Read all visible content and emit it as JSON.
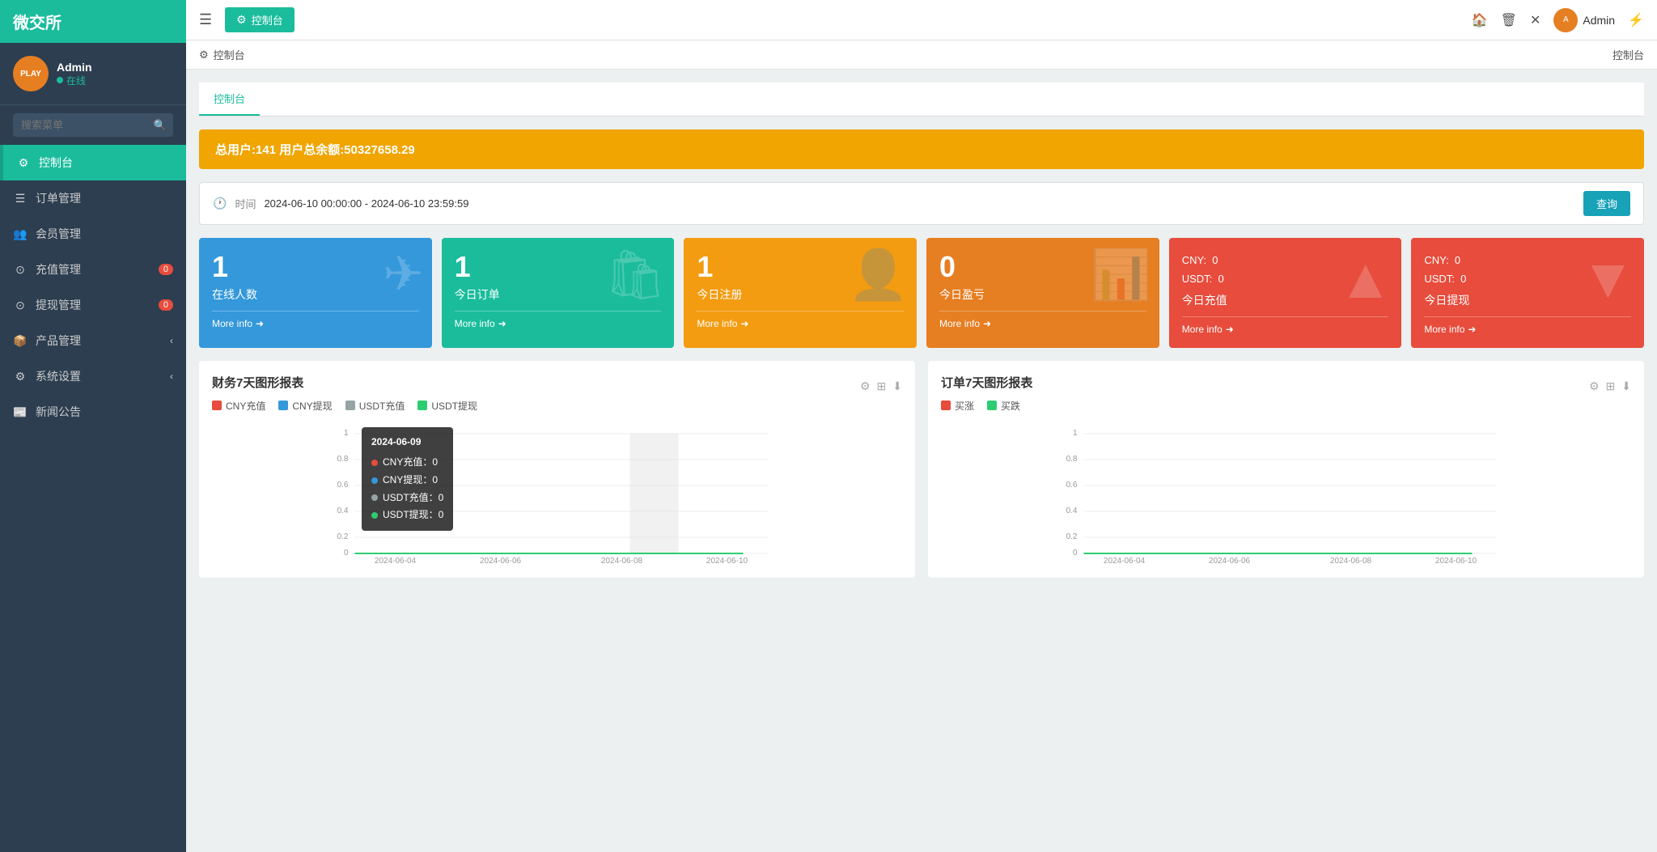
{
  "app": {
    "title": "微交所",
    "logo_text": "微交所"
  },
  "user": {
    "name": "Admin",
    "status": "在线",
    "avatar_text": "PLAY"
  },
  "sidebar": {
    "search_placeholder": "搜索菜单",
    "nav_items": [
      {
        "id": "dashboard",
        "label": "控制台",
        "icon": "⚙",
        "active": true,
        "badge": null,
        "arrow": false
      },
      {
        "id": "orders",
        "label": "订单管理",
        "icon": "☰",
        "active": false,
        "badge": null,
        "arrow": false
      },
      {
        "id": "members",
        "label": "会员管理",
        "icon": "👥",
        "active": false,
        "badge": null,
        "arrow": false
      },
      {
        "id": "recharge",
        "label": "充值管理",
        "icon": "◎",
        "active": false,
        "badge": "0",
        "arrow": false
      },
      {
        "id": "withdraw",
        "label": "提现管理",
        "icon": "◎",
        "active": false,
        "badge": "0",
        "arrow": false
      },
      {
        "id": "products",
        "label": "产品管理",
        "icon": "📦",
        "active": false,
        "badge": null,
        "arrow": true
      },
      {
        "id": "settings",
        "label": "系统设置",
        "icon": "⚙",
        "active": false,
        "badge": null,
        "arrow": true
      },
      {
        "id": "news",
        "label": "新闻公告",
        "icon": "📰",
        "active": false,
        "badge": null,
        "arrow": false
      }
    ]
  },
  "topbar": {
    "tab_label": "控制台",
    "tab_icon": "⚙",
    "user_name": "Admin",
    "breadcrumb_left": "控制台",
    "breadcrumb_right": "控制台"
  },
  "stats_banner": {
    "text": "总用户:141   用户总余额:50327658.29"
  },
  "date_filter": {
    "label": "时间",
    "value": "2024-06-10 00:00:00 - 2024-06-10 23:59:59",
    "btn_label": "查询"
  },
  "metric_cards": [
    {
      "id": "online_users",
      "number": "1",
      "label": "在线人数",
      "more": "More info",
      "bg_icon": "✈",
      "color": "blue"
    },
    {
      "id": "today_orders",
      "number": "1",
      "label": "今日订单",
      "more": "More info",
      "bg_icon": "🛍",
      "color": "green"
    },
    {
      "id": "today_register",
      "number": "1",
      "label": "今日注册",
      "more": "More info",
      "bg_icon": "👤",
      "color": "orange"
    },
    {
      "id": "today_profit",
      "number": "0",
      "label": "今日盈亏",
      "more": "More info",
      "bg_icon": "📊",
      "color": "yellow_dark"
    },
    {
      "id": "today_recharge",
      "label": "今日充值",
      "more": "More info",
      "sub_lines": [
        "CNY:  0",
        "USDT:  0"
      ],
      "bg_icon": "▲",
      "color": "red"
    },
    {
      "id": "today_withdraw",
      "label": "今日提现",
      "more": "More info",
      "sub_lines": [
        "CNY:  0",
        "USDT:  0"
      ],
      "bg_icon": "▼",
      "color": "red"
    }
  ],
  "finance_chart": {
    "title": "财务7天图形报表",
    "legend": [
      {
        "label": "CNY充值",
        "color": "#e74c3c"
      },
      {
        "label": "CNY提现",
        "color": "#3498db"
      },
      {
        "label": "USDT充值",
        "color": "#95a5a6"
      },
      {
        "label": "USDT提现",
        "color": "#2ecc71"
      }
    ],
    "x_labels": [
      "2024-06-04",
      "2024-06-06",
      "2024-06-08",
      "2024-06-10"
    ],
    "y_labels": [
      "0",
      "0.2",
      "0.4",
      "0.6",
      "0.8",
      "1"
    ],
    "tooltip": {
      "date": "2024-06-09",
      "rows": [
        {
          "label": "CNY充值：0",
          "color": "#e74c3c"
        },
        {
          "label": "CNY提现：0",
          "color": "#3498db"
        },
        {
          "label": "USDT充值：0",
          "color": "#95a5a6"
        },
        {
          "label": "USDT提现：0",
          "color": "#2ecc71"
        }
      ]
    }
  },
  "order_chart": {
    "title": "订单7天图形报表",
    "legend": [
      {
        "label": "买涨",
        "color": "#e74c3c"
      },
      {
        "label": "买跌",
        "color": "#2ecc71"
      }
    ],
    "x_labels": [
      "2024-06-04",
      "2024-06-06",
      "2024-06-08",
      "2024-06-10"
    ],
    "y_labels": [
      "0",
      "0.2",
      "0.4",
      "0.6",
      "0.8",
      "1"
    ]
  },
  "tabs": [
    {
      "label": "控制台",
      "active": true
    }
  ]
}
